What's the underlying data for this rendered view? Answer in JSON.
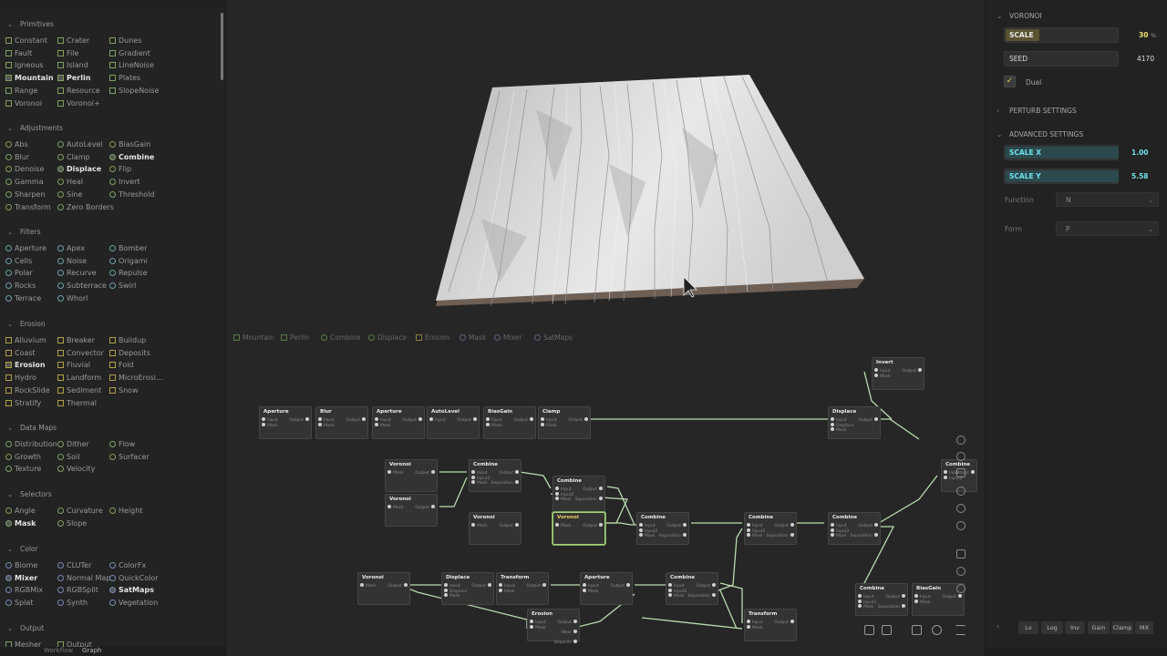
{
  "library": {
    "sections": [
      {
        "key": "primitives",
        "title": "Primitives",
        "items": [
          [
            "Constant",
            "Crater",
            "Dunes"
          ],
          [
            "Fault",
            "File",
            "Gradient"
          ],
          [
            "Igneous",
            "Island",
            "LineNoise"
          ],
          [
            "Mountain",
            "Perlin",
            "Plates"
          ],
          [
            "Range",
            "Resource",
            "SlopeNoise"
          ],
          [
            "Voronoi",
            "Voronoi+",
            ""
          ]
        ]
      },
      {
        "key": "adjustments",
        "title": "Adjustments",
        "items": [
          [
            "Abs",
            "AutoLevel",
            "BiasGain"
          ],
          [
            "Blur",
            "Clamp",
            "Combine"
          ],
          [
            "Denoise",
            "Displace",
            "Flip"
          ],
          [
            "Gamma",
            "Heal",
            "Invert"
          ],
          [
            "Sharpen",
            "Sine",
            "Threshold"
          ],
          [
            "Transform",
            "Zero Borders",
            ""
          ]
        ]
      },
      {
        "key": "filters",
        "title": "Filters",
        "items": [
          [
            "Aperture",
            "Apex",
            "Bomber"
          ],
          [
            "Cells",
            "Noise",
            "Origami"
          ],
          [
            "Polar",
            "Recurve",
            "Repulse"
          ],
          [
            "Rocks",
            "Subterrace",
            "Swirl"
          ],
          [
            "Terrace",
            "Whorl",
            ""
          ]
        ]
      },
      {
        "key": "erosion",
        "title": "Erosion",
        "items": [
          [
            "Alluvium",
            "Breaker",
            "Buildup"
          ],
          [
            "Coast",
            "Convector",
            "Deposits"
          ],
          [
            "Erosion",
            "Fluvial",
            "Fold"
          ],
          [
            "Hydro",
            "Landform",
            "MicroErosi…"
          ],
          [
            "RockSlide",
            "Sediment",
            "Snow"
          ],
          [
            "Stratify",
            "Thermal",
            ""
          ]
        ]
      },
      {
        "key": "datamaps",
        "title": "Data Maps",
        "items": [
          [
            "Distribution",
            "Dither",
            "Flow"
          ],
          [
            "Growth",
            "Soil",
            "Surfacer"
          ],
          [
            "Texture",
            "Velocity",
            ""
          ]
        ]
      },
      {
        "key": "selectors",
        "title": "Selectors",
        "items": [
          [
            "Angle",
            "Curvature",
            "Height"
          ],
          [
            "Mask",
            "Slope",
            ""
          ]
        ]
      },
      {
        "key": "color",
        "title": "Color",
        "items": [
          [
            "Biome",
            "CLUTer",
            "ColorFx"
          ],
          [
            "Mixer",
            "Normal Map",
            "QuickColor"
          ],
          [
            "RGBMix",
            "RGBSplit",
            "SatMaps"
          ],
          [
            "Splat",
            "Synth",
            "Vegetation"
          ]
        ]
      },
      {
        "key": "output",
        "title": "Output",
        "items": [
          [
            "Mesher",
            "Output",
            ""
          ]
        ]
      }
    ],
    "active_items": [
      "Mountain",
      "Perlin",
      "Combine",
      "Displace",
      "Erosion",
      "Mask",
      "Mixer",
      "SatMaps"
    ],
    "bottom": {
      "left": "Workflow",
      "mode": "Graph"
    }
  },
  "viewport": {
    "quick_tabs": [
      "Mountain",
      "Perlin",
      "Combine",
      "Displace",
      "Erosion",
      "Mask",
      "Mixer",
      "SatMaps"
    ]
  },
  "graph": {
    "nodes": [
      {
        "title": "Aperture",
        "ins": [
          "Input",
          "Mask"
        ],
        "outs": [
          "Output"
        ]
      },
      {
        "title": "Blur",
        "ins": [
          "Input",
          "Mask"
        ],
        "outs": [
          "Output"
        ]
      },
      {
        "title": "Aperture",
        "ins": [
          "Input",
          "Mask"
        ],
        "outs": [
          "Output"
        ]
      },
      {
        "title": "AutoLevel",
        "ins": [
          "Input"
        ],
        "outs": [
          "Output"
        ]
      },
      {
        "title": "BiasGain",
        "ins": [
          "Input",
          "Mask"
        ],
        "outs": [
          "Output"
        ]
      },
      {
        "title": "Clamp",
        "ins": [
          "Input",
          "Mask"
        ],
        "outs": [
          "Output"
        ]
      },
      {
        "title": "Displace",
        "ins": [
          "Input",
          "Displace",
          "Mask"
        ],
        "outs": [
          "Output"
        ]
      },
      {
        "title": "Invert",
        "ins": [
          "Input",
          "Mask"
        ],
        "outs": [
          "Output"
        ]
      },
      {
        "title": "Voronoi",
        "ins": [
          "Mask"
        ],
        "outs": [
          "Output"
        ]
      },
      {
        "title": "Voronoi",
        "ins": [
          "Mask"
        ],
        "outs": [
          "Output"
        ]
      },
      {
        "title": "Combine",
        "ins": [
          "Input",
          "Input2",
          "Mask"
        ],
        "outs": [
          "Output",
          "Separation"
        ]
      },
      {
        "title": "Combine",
        "ins": [
          "Input",
          "Input2",
          "Mask"
        ],
        "outs": [
          "Output",
          "Separation"
        ]
      },
      {
        "title": "Voronoi",
        "ins": [
          "Mask"
        ],
        "outs": [
          "Output"
        ]
      },
      {
        "title": "Voronoi",
        "ins": [
          "Mask"
        ],
        "outs": [
          "Output"
        ]
      },
      {
        "title": "Combine",
        "ins": [
          "Input",
          "Input2",
          "Mask"
        ],
        "outs": [
          "Output",
          "Separation"
        ]
      },
      {
        "title": "Combine",
        "ins": [
          "Input",
          "Input2",
          "Mask"
        ],
        "outs": [
          "Output",
          "Separation"
        ]
      },
      {
        "title": "Combine",
        "ins": [
          "Input",
          "Input2",
          "Mask"
        ],
        "outs": [
          "Output",
          "Separation"
        ]
      },
      {
        "title": "Voronoi",
        "ins": [
          "Mask"
        ],
        "outs": [
          "Output"
        ]
      },
      {
        "title": "Displace",
        "ins": [
          "Input",
          "Displace",
          "Mask"
        ],
        "outs": [
          "Output"
        ]
      },
      {
        "title": "Transform",
        "ins": [
          "Input",
          "Mask"
        ],
        "outs": [
          "Output"
        ]
      },
      {
        "title": "Aperture",
        "ins": [
          "Input",
          "Mask"
        ],
        "outs": [
          "Output"
        ]
      },
      {
        "title": "Combine",
        "ins": [
          "Input",
          "Input2",
          "Mask"
        ],
        "outs": [
          "Output",
          "Separation"
        ]
      },
      {
        "title": "Erosion",
        "ins": [
          "Input",
          "Mask"
        ],
        "outs": [
          "Output",
          "Wear",
          "Deposits"
        ]
      },
      {
        "title": "Transform",
        "ins": [
          "Input",
          "Mask"
        ],
        "outs": [
          "Output"
        ]
      },
      {
        "title": "Combine",
        "ins": [
          "Input",
          "Input2",
          "Mask"
        ],
        "outs": [
          "Output",
          "Separation"
        ]
      },
      {
        "title": "BiasGain",
        "ins": [
          "Input",
          "Mask"
        ],
        "outs": [
          "Output"
        ]
      },
      {
        "title": "Combine",
        "ins": [
          "Input",
          "Input2"
        ],
        "outs": [
          "Output"
        ]
      }
    ]
  },
  "properties": {
    "title": "VORONOI",
    "scale": {
      "label": "SCALE",
      "value": "30",
      "unit": "%"
    },
    "seed": {
      "label": "SEED",
      "value": "4170"
    },
    "dual": {
      "label": "Dual",
      "checked": true
    },
    "perturb_title": "PERTURB SETTINGS",
    "advanced_title": "ADVANCED SETTINGS",
    "scale_x": {
      "label": "SCALE X",
      "value": "1.00"
    },
    "scale_y": {
      "label": "SCALE Y",
      "value": "5.58"
    },
    "function": {
      "label": "Function",
      "value": "N"
    },
    "form": {
      "label": "Form",
      "value": "P"
    },
    "bottom_tabs": [
      "Lv",
      "Log",
      "Inv",
      "Gain",
      "Clamp",
      "MX"
    ]
  },
  "colors": {
    "accent_yellow": "#e8d24a",
    "accent_cyan": "#6fe0ee",
    "wire": "#b9dcae",
    "selected_node": "#a6d27d"
  }
}
